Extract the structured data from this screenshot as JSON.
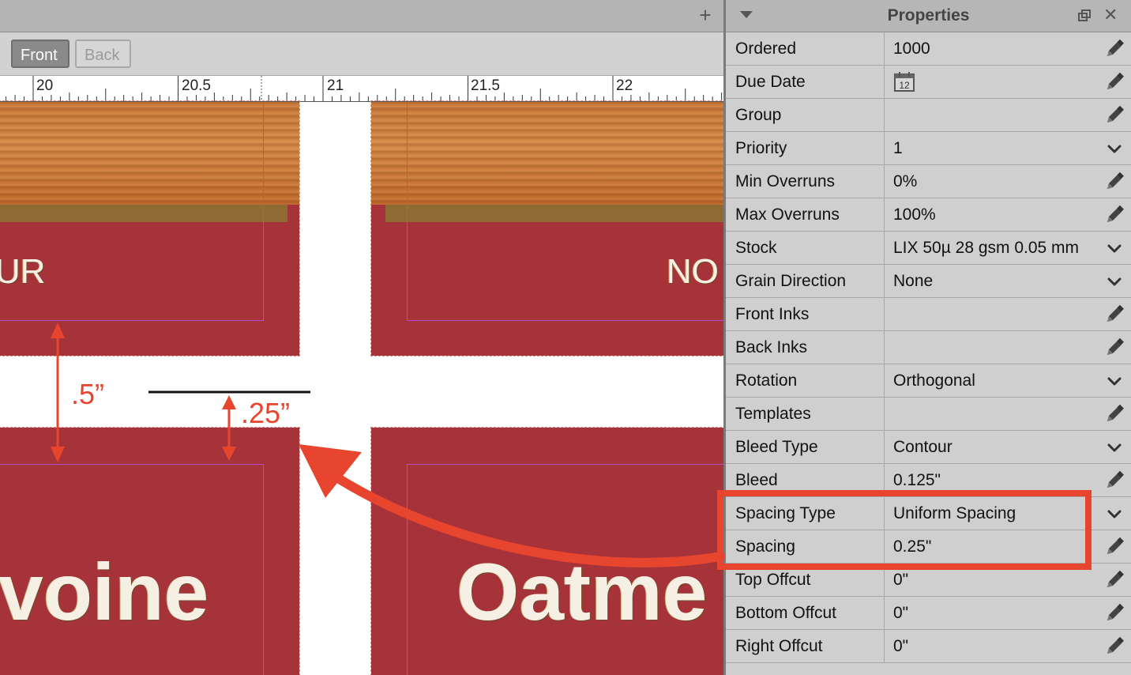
{
  "canvas": {
    "face_buttons": {
      "front": "Front",
      "back": "Back"
    },
    "ruler_labels": [
      "20",
      "20.5",
      "21",
      "21.5",
      "22"
    ],
    "card_texts": {
      "top_left": "UR",
      "top_right": "NO",
      "bottom_left": "voine",
      "bottom_right": "Oatme"
    }
  },
  "annotations": {
    "gap_large": ".5”",
    "gap_small": ".25”",
    "highlight_color": "#e8452e"
  },
  "properties": {
    "title": "Properties",
    "rows": [
      {
        "label": "Ordered",
        "value": "1000",
        "control": "pencil-icon"
      },
      {
        "label": "Due Date",
        "value": "",
        "calendar_day": "12",
        "control": "pencil-icon"
      },
      {
        "label": "Group",
        "value": "",
        "control": "pencil-icon"
      },
      {
        "label": "Priority",
        "value": "1",
        "control": "chevron-down-icon"
      },
      {
        "label": "Min Overruns",
        "value": "0%",
        "control": "pencil-icon"
      },
      {
        "label": "Max Overruns",
        "value": "100%",
        "control": "pencil-icon"
      },
      {
        "label": "Stock",
        "value": "LIX 50µ 28 gsm 0.05 mm",
        "control": "chevron-down-icon"
      },
      {
        "label": "Grain Direction",
        "value": "None",
        "control": "chevron-down-icon"
      },
      {
        "label": "Front Inks",
        "value": "",
        "control": "pencil-icon"
      },
      {
        "label": "Back Inks",
        "value": "",
        "control": "pencil-icon"
      },
      {
        "label": "Rotation",
        "value": "Orthogonal",
        "control": "chevron-down-icon"
      },
      {
        "label": "Templates",
        "value": "",
        "control": "pencil-icon"
      },
      {
        "label": "Bleed Type",
        "value": "Contour",
        "control": "chevron-down-icon"
      },
      {
        "label": "Bleed",
        "value": "0.125\"",
        "control": "pencil-icon"
      },
      {
        "label": "Spacing Type",
        "value": "Uniform Spacing",
        "control": "chevron-down-icon"
      },
      {
        "label": "Spacing",
        "value": "0.25\"",
        "control": "pencil-icon"
      },
      {
        "label": "Top Offcut",
        "value": "0\"",
        "control": "pencil-icon"
      },
      {
        "label": "Bottom Offcut",
        "value": "0\"",
        "control": "pencil-icon"
      },
      {
        "label": "Right Offcut",
        "value": "0\"",
        "control": "pencil-icon"
      }
    ]
  }
}
